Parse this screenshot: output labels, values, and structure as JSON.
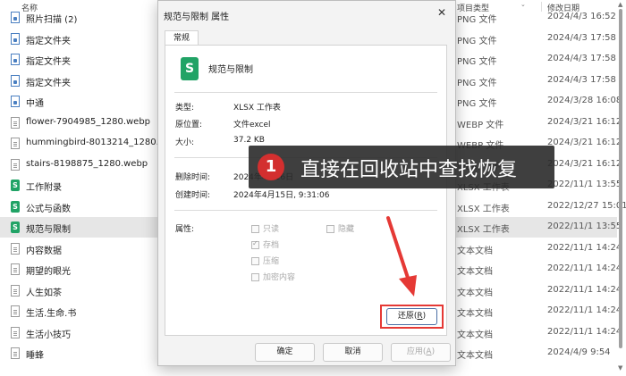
{
  "explorer": {
    "columns": {
      "name": "名称",
      "type": "项目类型",
      "date": "修改日期"
    },
    "files": [
      {
        "name": "照片扫描 (2)",
        "type": "PNG 文件",
        "date": "2024/4/3 16:52",
        "icon": "image-file-icon",
        "selected": false
      },
      {
        "name": "指定文件夹",
        "type": "PNG 文件",
        "date": "2024/4/3 17:58",
        "icon": "image-file-icon",
        "selected": false
      },
      {
        "name": "指定文件夹",
        "type": "PNG 文件",
        "date": "2024/4/3 17:58",
        "icon": "image-file-icon",
        "selected": false
      },
      {
        "name": "指定文件夹",
        "type": "PNG 文件",
        "date": "2024/4/3 17:58",
        "icon": "image-file-icon",
        "selected": false
      },
      {
        "name": "中通",
        "type": "PNG 文件",
        "date": "2024/3/28 16:08",
        "icon": "image-file-icon",
        "selected": false
      },
      {
        "name": "flower-7904985_1280.webp",
        "type": "WEBP 文件",
        "date": "2024/3/21 16:12",
        "icon": "document-file-icon",
        "selected": false
      },
      {
        "name": "hummingbird-8013214_1280.webp",
        "type": "WEBP 文件",
        "date": "2024/3/21 16:12",
        "icon": "document-file-icon",
        "selected": false
      },
      {
        "name": "stairs-8198875_1280.webp",
        "type": "WEBP 文件",
        "date": "2024/3/21 16:12",
        "icon": "document-file-icon",
        "selected": false
      },
      {
        "name": "工作附录",
        "type": "XLSX 工作表",
        "date": "2022/11/1 13:55",
        "icon": "spreadsheet-file-icon",
        "selected": false
      },
      {
        "name": "公式与函数",
        "type": "XLSX 工作表",
        "date": "2022/12/27 15:01",
        "icon": "spreadsheet-file-icon",
        "selected": false
      },
      {
        "name": "规范与限制",
        "type": "XLSX 工作表",
        "date": "2022/11/1 13:55",
        "icon": "spreadsheet-file-icon",
        "selected": true
      },
      {
        "name": "内容数据",
        "type": "文本文档",
        "date": "2022/11/1 14:24",
        "icon": "document-file-icon",
        "selected": false
      },
      {
        "name": "期望的眼光",
        "type": "文本文档",
        "date": "2022/11/1 14:24",
        "icon": "document-file-icon",
        "selected": false
      },
      {
        "name": "人生如茶",
        "type": "文本文档",
        "date": "2022/11/1 14:24",
        "icon": "document-file-icon",
        "selected": false
      },
      {
        "name": "生活.生命.书",
        "type": "文本文档",
        "date": "2022/11/1 14:24",
        "icon": "document-file-icon",
        "selected": false
      },
      {
        "name": "生活小技巧",
        "type": "文本文档",
        "date": "2022/11/1 14:24",
        "icon": "document-file-icon",
        "selected": false
      },
      {
        "name": "睡蜂",
        "type": "文本文档",
        "date": "2024/4/9 9:54",
        "icon": "document-file-icon",
        "selected": false
      }
    ]
  },
  "dialog": {
    "title": "规范与限制 属性",
    "close": "✕",
    "tab": "常规",
    "filename": "规范与限制",
    "type_label": "类型:",
    "type_value": "XLSX 工作表",
    "location_label": "原位置:",
    "location_value": "文件excel",
    "size_label": "大小:",
    "size_value": "37.2 KB",
    "deleted_label": "删除时间:",
    "deleted_value": "2024年4月16日",
    "created_label": "创建时间:",
    "created_value": "2024年4月15日, 9:31:06",
    "attributes_label": "属性:",
    "attributes": {
      "readonly": "只读",
      "hidden": "隐藏",
      "archive": "存档",
      "compressed": "压缩",
      "encrypted": "加密内容"
    },
    "restore_button": "还原(",
    "restore_key": "R",
    "restore_tail": ")",
    "ok_button": "确定",
    "cancel_button": "取消",
    "apply_button": "应用(",
    "apply_key": "A",
    "apply_tail": ")"
  },
  "callout": {
    "step": "1",
    "text": "直接在回收站中查找恢复"
  },
  "colors": {
    "accent_red": "#e53935",
    "callout_bg": "#2a2a2a",
    "excel_green": "#21a366",
    "selected_row": "#e6e6e6"
  }
}
